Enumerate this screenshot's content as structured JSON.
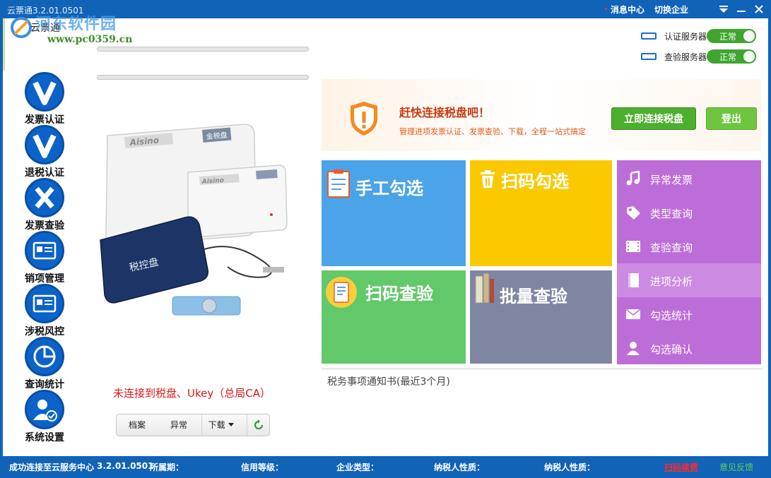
{
  "window": {
    "title": "云票通3.2.01.0501",
    "msg_center": "消息中心",
    "switch_company": "切换企业"
  },
  "logo": {
    "app_name": "云票通",
    "watermark_cn": "河东软件园",
    "watermark_url": "www.pc0359.cn"
  },
  "sidebar": {
    "items": [
      {
        "label": "发票认证",
        "icon": "v-check-icon"
      },
      {
        "label": "退税认证",
        "icon": "v-check-icon"
      },
      {
        "label": "发票查验",
        "icon": "x-cross-icon"
      },
      {
        "label": "销项管理",
        "icon": "id-card-icon"
      },
      {
        "label": "涉税风控",
        "icon": "id-card-icon"
      },
      {
        "label": "查询统计",
        "icon": "pie-chart-icon"
      },
      {
        "label": "系统设置",
        "icon": "user-settings-icon"
      }
    ]
  },
  "device": {
    "brand1": "Aisino",
    "brand2": "Aisino",
    "model": "金税盘",
    "disk_label": "税控盘"
  },
  "connection": {
    "warning": "未连接到税盘、Ukey（总局CA）",
    "buttons": {
      "archive": "档案",
      "exception": "异常",
      "download": "下载"
    }
  },
  "servers": [
    {
      "label": "认证服务器",
      "status": "正常"
    },
    {
      "label": "查验服务器",
      "status": "正常"
    }
  ],
  "alert": {
    "title": "赶快连接税盘吧！",
    "subtitle": "管理进项发票认证、发票查验、下载，全程一站式搞定",
    "connect_btn": "立即连接税盘",
    "logout_btn": "登出"
  },
  "tiles": [
    {
      "label": "手工勾选",
      "color": "#4ba3e8"
    },
    {
      "label": "扫码勾选",
      "color": "#fbc900"
    },
    {
      "label": "扫码查验",
      "color": "#62c86a"
    },
    {
      "label": "批量查验",
      "color": "#7f86a2"
    }
  ],
  "menu": {
    "items": [
      {
        "label": "异常发票",
        "icon": "music-note-icon"
      },
      {
        "label": "类型查询",
        "icon": "tag-icon"
      },
      {
        "label": "查验查询",
        "icon": "film-icon"
      },
      {
        "label": "进项分析",
        "icon": "book-icon"
      },
      {
        "label": "勾选统计",
        "icon": "mail-icon"
      },
      {
        "label": "勾选确认",
        "icon": "user-icon"
      }
    ]
  },
  "notice": {
    "title": "税务事项通知书(最近3个月)"
  },
  "status": {
    "connected": "成功连接至云服务中心",
    "version": "3.2.01.0501",
    "period": "所属期：",
    "credit": "信用等级：",
    "company_type": "企业类型：",
    "taxpayer1": "纳税人性质：",
    "taxpayer2": "纳税人性质：",
    "scan_fee": "扫码续费",
    "feedback": "意见反馈"
  },
  "colors": {
    "primary": "#1163b8",
    "alert_red": "#c83a0f",
    "green": "#4caf2e",
    "menu_purple": "#bd6dd8"
  }
}
